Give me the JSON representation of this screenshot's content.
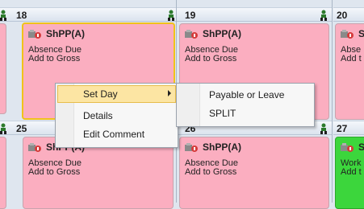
{
  "calendar": {
    "days": [
      {
        "num": "18"
      },
      {
        "num": "19"
      },
      {
        "num": "20"
      },
      {
        "num": "25"
      },
      {
        "num": "26"
      },
      {
        "num": "27"
      }
    ],
    "cells": [
      {
        "code": "ShPP(A)",
        "desc": "Absence Due\nAdd to Gross"
      },
      {
        "code": "ShPP(A)",
        "desc": "Absence Due\nAdd to Gross"
      },
      {
        "code": "ShPP(A)",
        "desc": "Absence Due\nAdd to Gross"
      },
      {
        "code": "ShPP(A)",
        "desc": "Absence Due\nAdd to Gross"
      },
      {
        "code": "S",
        "desc": "Work\nAdd t"
      },
      {
        "code": "S",
        "desc": "Abse\nAdd t"
      }
    ]
  },
  "context_menu": {
    "items": [
      {
        "label": "Set Day"
      },
      {
        "label": "Details"
      },
      {
        "label": "Edit Comment"
      }
    ]
  },
  "submenu": {
    "items": [
      {
        "label": "Payable or Leave"
      },
      {
        "label": "SPLIT"
      }
    ]
  },
  "colors": {
    "absence_cell": "#fbaec0",
    "work_cell": "#3cd63c",
    "selection_border": "#f0c21a",
    "menu_highlight": "#fce5a3"
  },
  "icons": {
    "person": "person-icon",
    "shift": "shift-icon",
    "submenu_arrow": "submenu-arrow-icon"
  }
}
